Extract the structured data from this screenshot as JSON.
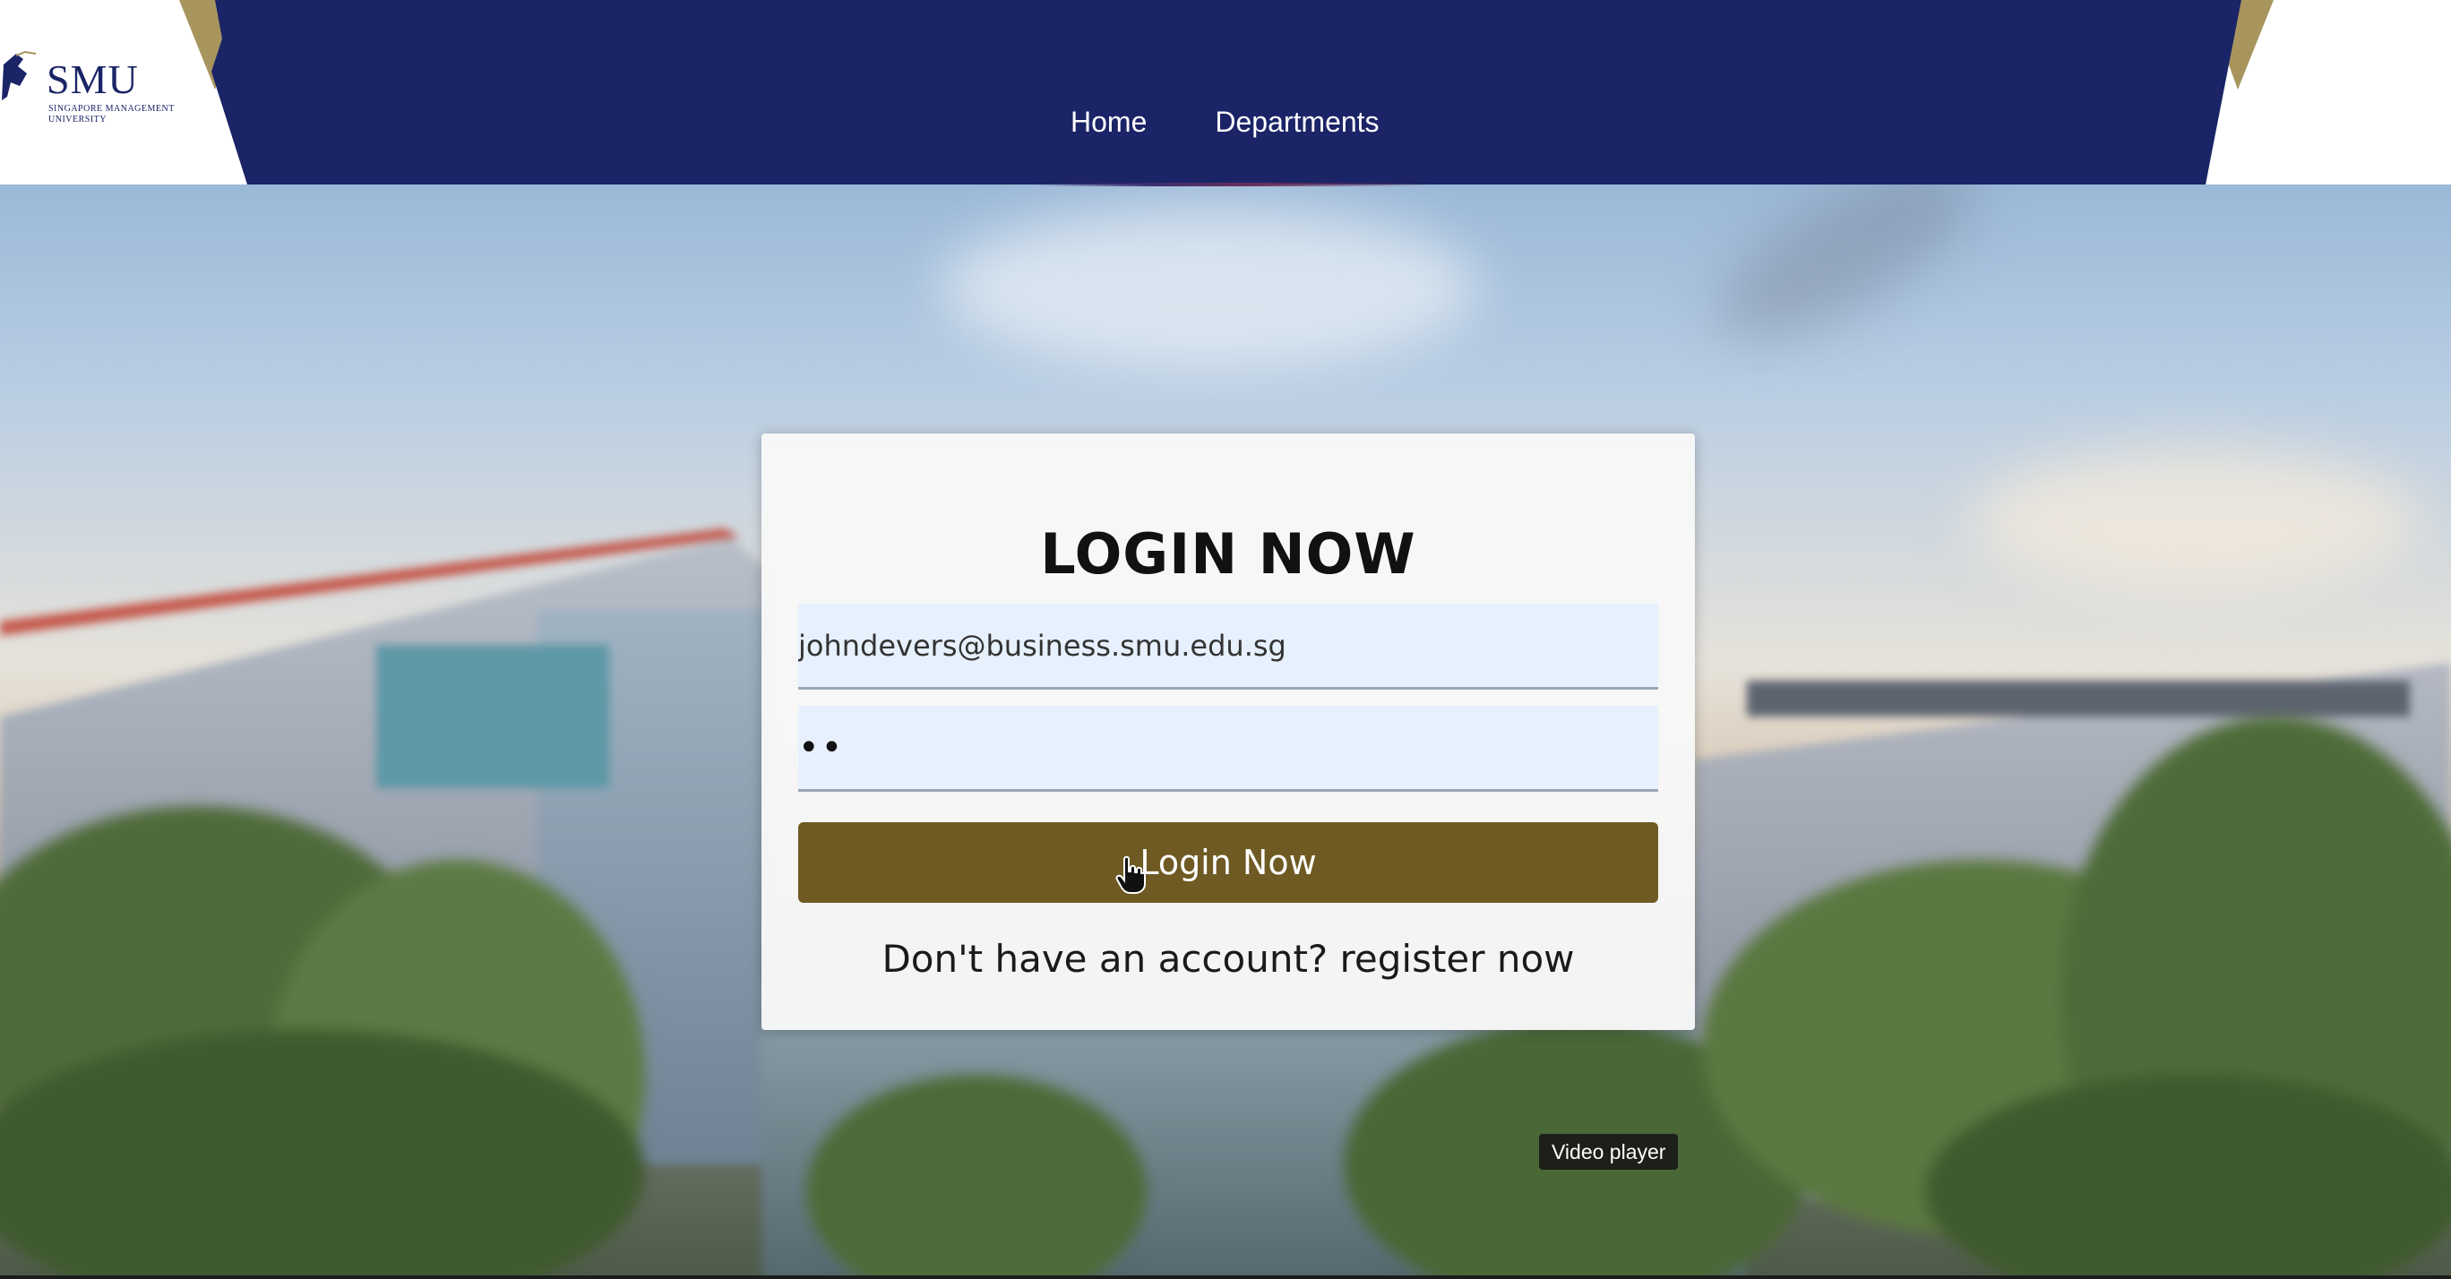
{
  "header": {
    "logo_text": "SMU",
    "logo_subtext": "SINGAPORE MANAGEMENT UNIVERSITY",
    "nav": [
      {
        "label": "Home"
      },
      {
        "label": "Departments"
      }
    ]
  },
  "login": {
    "title": "LOGIN NOW",
    "email_value": "johndevers@business.smu.edu.sg",
    "password_value": "••",
    "button_label": "Login Now",
    "register_text": "Don't have an account? register now"
  },
  "tooltip": {
    "text": "Video player"
  },
  "colors": {
    "header_navy": "#1a2466",
    "header_gold": "#a8955e",
    "button_brown": "#6e5a22",
    "input_bg": "#e7f0fd"
  },
  "icons": {
    "cursor": "hand-pointer-icon",
    "logo": "smu-lion-logo-icon"
  }
}
